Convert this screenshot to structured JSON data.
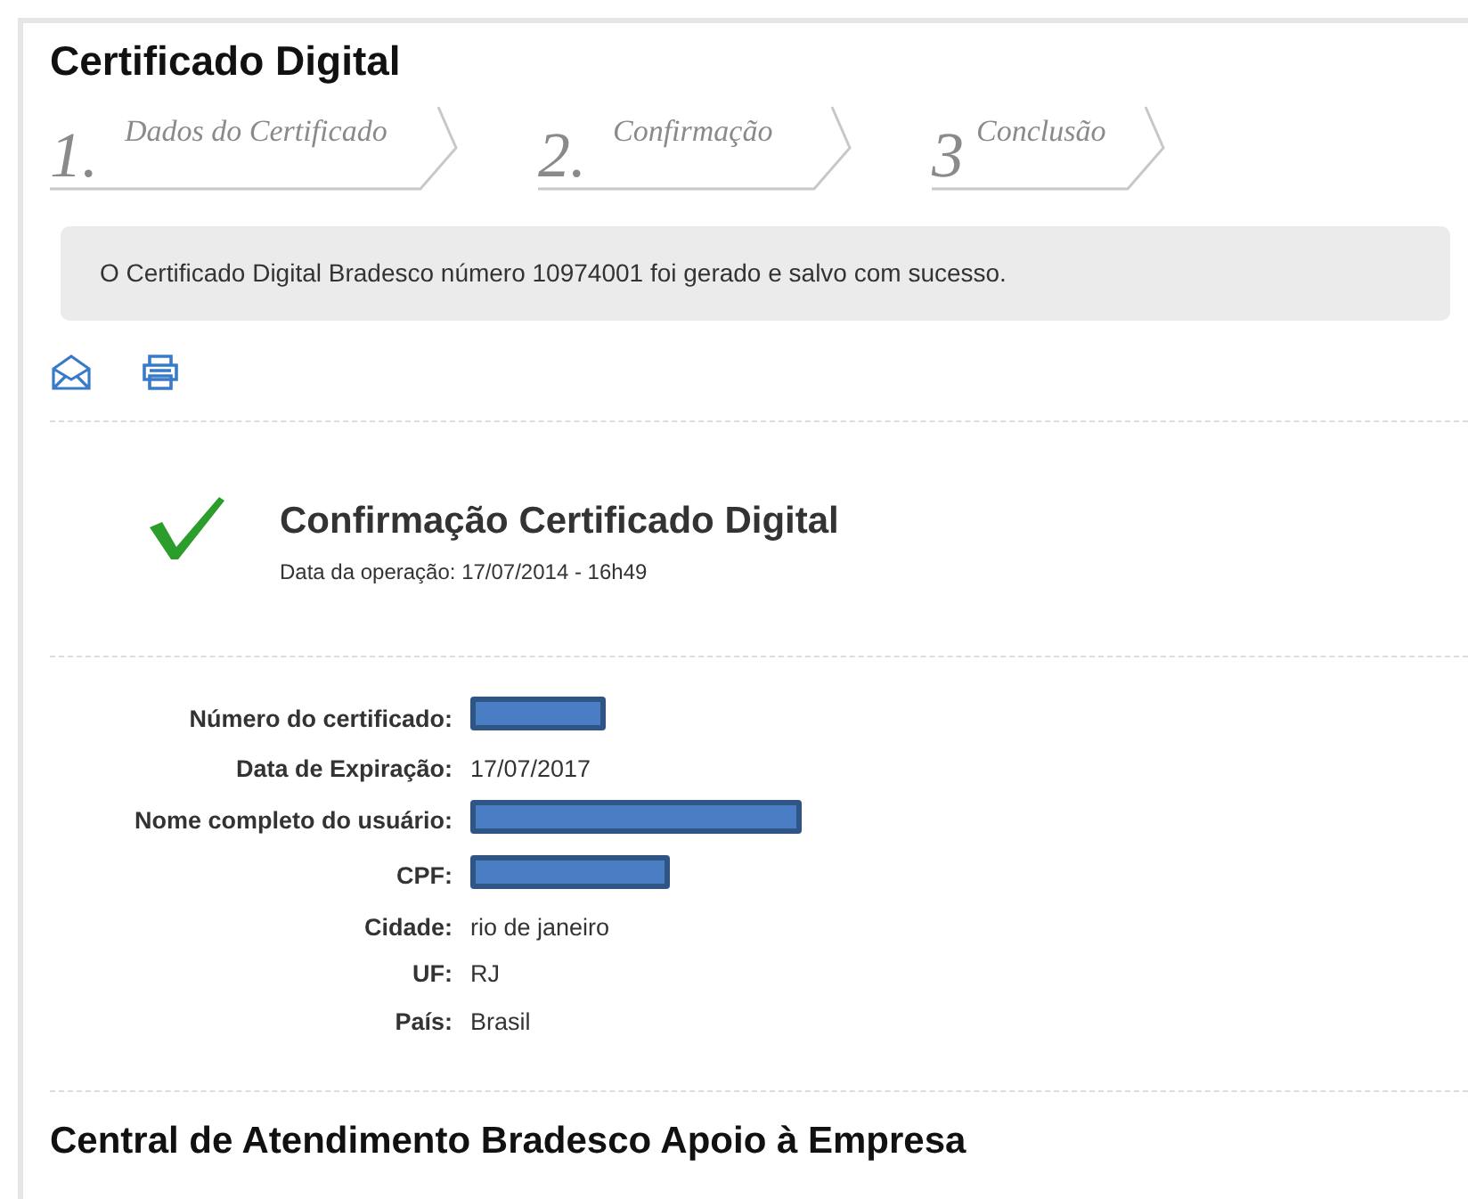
{
  "title": "Certificado Digital",
  "steps": [
    {
      "number": "1.",
      "label": "Dados do Certificado"
    },
    {
      "number": "2.",
      "label": "Confirmação"
    },
    {
      "number": "3",
      "label": "Conclusão"
    }
  ],
  "alert": "O Certificado Digital Bradesco número 10974001 foi gerado e salvo com sucesso.",
  "confirmation": {
    "title": "Confirmação Certificado Digital",
    "subtitle": "Data da operação: 17/07/2014 - 16h49"
  },
  "details": [
    {
      "label": "Número do certificado:",
      "kind": "redacted"
    },
    {
      "label": "Data de Expiração:",
      "kind": "text",
      "value": "17/07/2017"
    },
    {
      "label": "Nome completo do usuário:",
      "kind": "redacted"
    },
    {
      "label": "CPF:",
      "kind": "redacted"
    },
    {
      "label": "Cidade:",
      "kind": "text",
      "value": "rio de janeiro"
    },
    {
      "label": "UF:",
      "kind": "text",
      "value": "RJ"
    },
    {
      "label": "País:",
      "kind": "text",
      "value": "Brasil"
    }
  ],
  "footer_heading": "Central de Atendimento Bradesco Apoio à Empresa"
}
